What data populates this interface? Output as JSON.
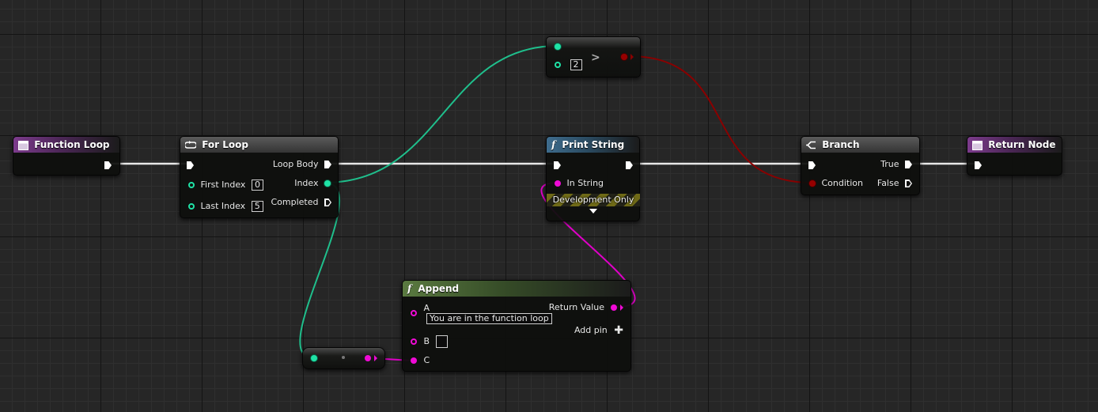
{
  "graph": {
    "nodes": {
      "function_loop": {
        "title": "Function Loop"
      },
      "for_loop": {
        "title": "For Loop",
        "first_index_label": "First Index",
        "first_index_value": "0",
        "last_index_label": "Last Index",
        "last_index_value": "5",
        "loop_body_label": "Loop Body",
        "index_label": "Index",
        "completed_label": "Completed"
      },
      "compare": {
        "operator": ">",
        "value": "2"
      },
      "print_string": {
        "title": "Print String",
        "in_string_label": "In String",
        "dev_only_label": "Development Only"
      },
      "branch": {
        "title": "Branch",
        "condition_label": "Condition",
        "true_label": "True",
        "false_label": "False"
      },
      "return_node": {
        "title": "Return Node"
      },
      "append": {
        "title": "Append",
        "a_label": "A",
        "a_value": "You are in the function loop",
        "b_label": "B",
        "b_value": "",
        "c_label": "C",
        "return_label": "Return Value",
        "add_pin_label": "Add pin"
      }
    }
  },
  "colors": {
    "exec": "#ffffff",
    "integer": "#1fe3a6",
    "string": "#f00ad6",
    "boolean": "#960000",
    "function_header": "#3e6c8d",
    "event_header": "#7c3b8c",
    "pure_header": "#5a7a40"
  },
  "icons": {
    "function_entry": "function-entry-icon",
    "for_loop": "loop-icon",
    "function_call": "function-f-icon",
    "branch": "branch-icon",
    "add_pin": "plus-icon",
    "expand": "chevron-down-icon"
  }
}
